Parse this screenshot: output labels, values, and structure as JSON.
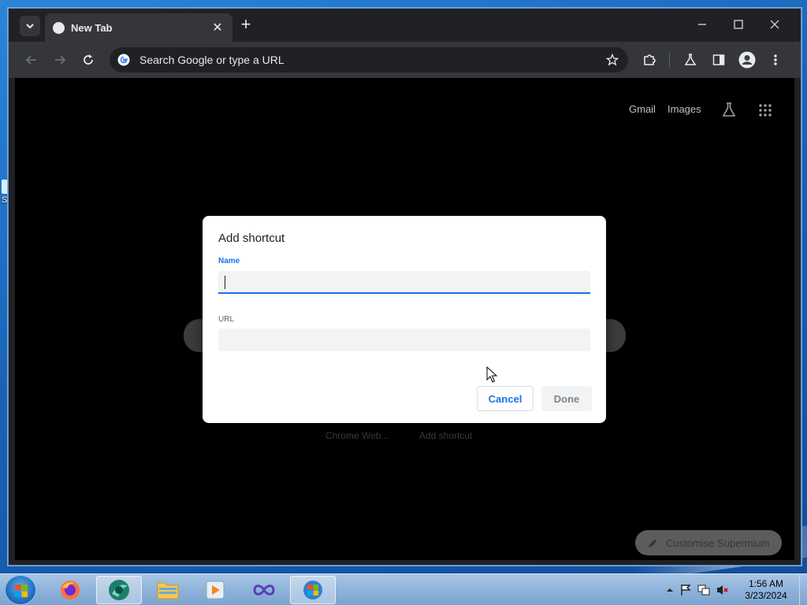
{
  "desktop": {
    "icon_label": "Su"
  },
  "browser": {
    "tab": {
      "title": "New Tab"
    },
    "omnibox": {
      "text": "Search Google or type a URL"
    },
    "header_links": {
      "gmail": "Gmail",
      "images": "Images"
    },
    "background": {
      "shortcut_label_1": "Chrome Web...",
      "shortcut_label_2": "Add shortcut",
      "customise_button": "Customise Supermium"
    }
  },
  "dialog": {
    "title": "Add shortcut",
    "name_label": "Name",
    "name_value": "",
    "url_label": "URL",
    "url_value": "",
    "cancel_label": "Cancel",
    "done_label": "Done"
  },
  "taskbar": {
    "apps": [
      "firefox",
      "supermium",
      "file-explorer",
      "media-player",
      "visual-studio",
      "windows-update"
    ],
    "clock_time": "1:56 AM",
    "clock_date": "3/23/2024"
  },
  "colors": {
    "accent": "#1a73e8",
    "dialog_bg": "#ffffff",
    "browser_bg": "#202124",
    "toolbar_bg": "#35363a"
  }
}
